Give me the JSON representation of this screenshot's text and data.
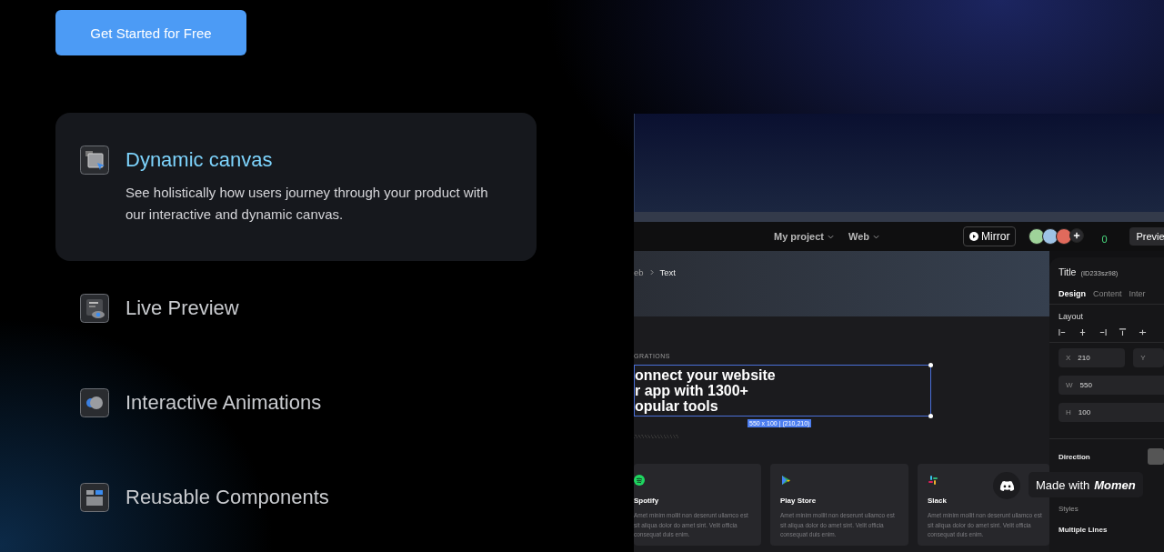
{
  "cta_button": "Get Started for Free",
  "features": [
    {
      "title": "Dynamic canvas",
      "description": "See holistically how users journey through your product with our interactive and dynamic canvas.",
      "selected": true
    },
    {
      "title": "Live Preview",
      "selected": false
    },
    {
      "title": "Interactive Animations",
      "selected": false
    },
    {
      "title": "Reusable Components",
      "selected": false
    }
  ],
  "app": {
    "toolbar": {
      "project": "My project",
      "platform": "Web",
      "mirror": "Mirror",
      "notification_count": "0",
      "preview": "Previe"
    },
    "breadcrumb": [
      "eb",
      "Text"
    ],
    "canvas": {
      "eyebrow": "GRATIONS",
      "heading_lines": [
        "onnect your website",
        "r app with 1300+",
        "opular tools"
      ],
      "size_label": "550 x 100 | (210,210)",
      "cards": [
        {
          "name": "Spotify",
          "text": "Amet minim mollit non deserunt ullamco est sit aliqua dolor do amet sint. Velit officia consequat duis enim."
        },
        {
          "name": "Play Store",
          "text": "Amet minim mollit non deserunt ullamco est sit aliqua dolor do amet sint. Velit officia consequat duis enim."
        },
        {
          "name": "Slack",
          "text": "Amet minim mollit non deserunt ullamco est sit aliqua dolor do amet sint. Velit officia consequat duis enim."
        }
      ]
    },
    "panel": {
      "title": "Title",
      "element_id": "(ID233sz98)",
      "tabs": [
        {
          "label": "Design",
          "selected": true
        },
        {
          "label": "Content",
          "selected": false
        },
        {
          "label": "Inter",
          "selected": false
        }
      ],
      "layout_label": "Layout",
      "position_fields": [
        {
          "label": "X",
          "value": "210"
        },
        {
          "label": "Y"
        }
      ],
      "size_fields": [
        {
          "label": "W",
          "value": "550"
        },
        {
          "label": "H",
          "value": "100"
        }
      ],
      "direction_label": "Direction",
      "styles_label": "Styles",
      "multiple_lines_label": "Multiple Lines"
    }
  },
  "badge": {
    "text": "Made with",
    "brand": "Momen"
  }
}
